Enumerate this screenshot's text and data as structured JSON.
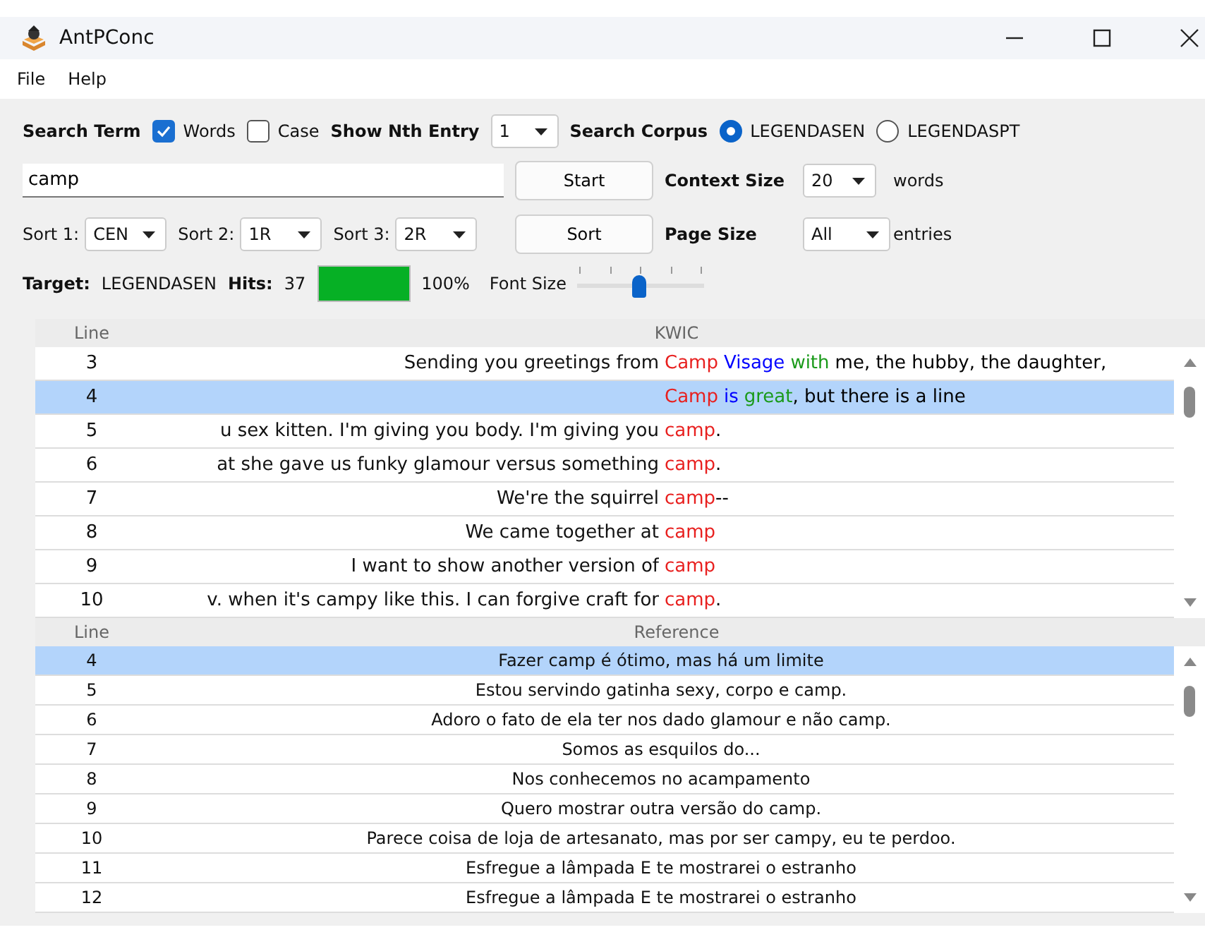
{
  "window": {
    "title": "AntPConc"
  },
  "menu": [
    "File",
    "Help"
  ],
  "search_row": {
    "label": "Search Term",
    "options": [
      {
        "label": "Words",
        "checked": true
      },
      {
        "label": "Case",
        "checked": false
      }
    ],
    "nth_label": "Show Nth Entry",
    "nth_value": "1",
    "corpus_label": "Search Corpus",
    "corpora": [
      {
        "label": "LEGENDASEN",
        "selected": true
      },
      {
        "label": "LEGENDASPT",
        "selected": false
      }
    ]
  },
  "query": {
    "value": "camp"
  },
  "start_button": "Start",
  "context": {
    "label": "Context Size",
    "value": "20",
    "unit": "words"
  },
  "sorts": [
    {
      "label": "Sort 1:",
      "value": "CEN"
    },
    {
      "label": "Sort 2:",
      "value": "1R"
    },
    {
      "label": "Sort 3:",
      "value": "2R"
    }
  ],
  "sort_button": "Sort",
  "page_size": {
    "label": "Page Size",
    "value": "All",
    "unit": "entries"
  },
  "status": {
    "target_label": "Target:",
    "target": "LEGENDASEN",
    "hits_label": "Hits:",
    "hits": "37",
    "progress": {
      "level": 1,
      "reading": "100%"
    },
    "font_size": {
      "label": "Font Size",
      "level": 0.49
    }
  },
  "kwic": {
    "columns": [
      "Line",
      "KWIC"
    ],
    "rows": [
      {
        "line": "3",
        "selected": false,
        "left": "Sending you greetings from",
        "keyword": "Camp",
        "right": [
          {
            "text": "Visage",
            "color": "#0000ff"
          },
          {
            "text": "with",
            "color": "#1a9a1a"
          },
          {
            "text": "me, the hubby, the daughter,",
            "color": "#000000"
          }
        ]
      },
      {
        "line": "4",
        "selected": true,
        "left": "",
        "keyword": "Camp",
        "right": [
          {
            "text": "is",
            "color": "#0000ff"
          },
          {
            "text": "great",
            "color": "#1a9a1a"
          },
          {
            "text": ", but there is a line",
            "color": "#000000"
          }
        ]
      },
      {
        "line": "5",
        "selected": false,
        "left": "u sex kitten. I'm giving you body. I'm giving you",
        "keyword": "camp",
        "right": [
          {
            "text": ".",
            "color": "#000000"
          }
        ]
      },
      {
        "line": "6",
        "selected": false,
        "left": "at she gave us funky glamour versus something",
        "keyword": "camp",
        "right": [
          {
            "text": ".",
            "color": "#000000"
          }
        ]
      },
      {
        "line": "7",
        "selected": false,
        "left": "We're the squirrel",
        "keyword": "camp",
        "right": [
          {
            "text": "--",
            "color": "#000000"
          }
        ]
      },
      {
        "line": "8",
        "selected": false,
        "left": "We came together at",
        "keyword": "camp",
        "right": []
      },
      {
        "line": "9",
        "selected": false,
        "left": "I want to show another version of",
        "keyword": "camp",
        "right": []
      },
      {
        "line": "10",
        "selected": false,
        "left": "v. when it's campy like this. I can forgive craft for",
        "keyword": "camp",
        "right": [
          {
            "text": ".",
            "color": "#000000"
          }
        ]
      }
    ]
  },
  "reference": {
    "columns": [
      "Line",
      "Reference"
    ],
    "rows": [
      {
        "line": "4",
        "selected": true,
        "text": "Fazer camp é ótimo, mas há um limite"
      },
      {
        "line": "5",
        "selected": false,
        "text": "Estou servindo gatinha sexy, corpo e camp."
      },
      {
        "line": "6",
        "selected": false,
        "text": "Adoro o fato de ela ter nos dado glamour e não camp."
      },
      {
        "line": "7",
        "selected": false,
        "text": "Somos as esquilos do..."
      },
      {
        "line": "8",
        "selected": false,
        "text": "Nos conhecemos no acampamento"
      },
      {
        "line": "9",
        "selected": false,
        "text": "Quero mostrar outra versão do camp."
      },
      {
        "line": "10",
        "selected": false,
        "text": "Parece coisa de loja de artesanato, mas por ser campy, eu te perdoo."
      },
      {
        "line": "11",
        "selected": false,
        "text": "Esfregue a lâmpada E te mostrarei o estranho"
      },
      {
        "line": "12",
        "selected": false,
        "text": "Esfregue a lâmpada E te mostrarei o estranho"
      }
    ]
  }
}
